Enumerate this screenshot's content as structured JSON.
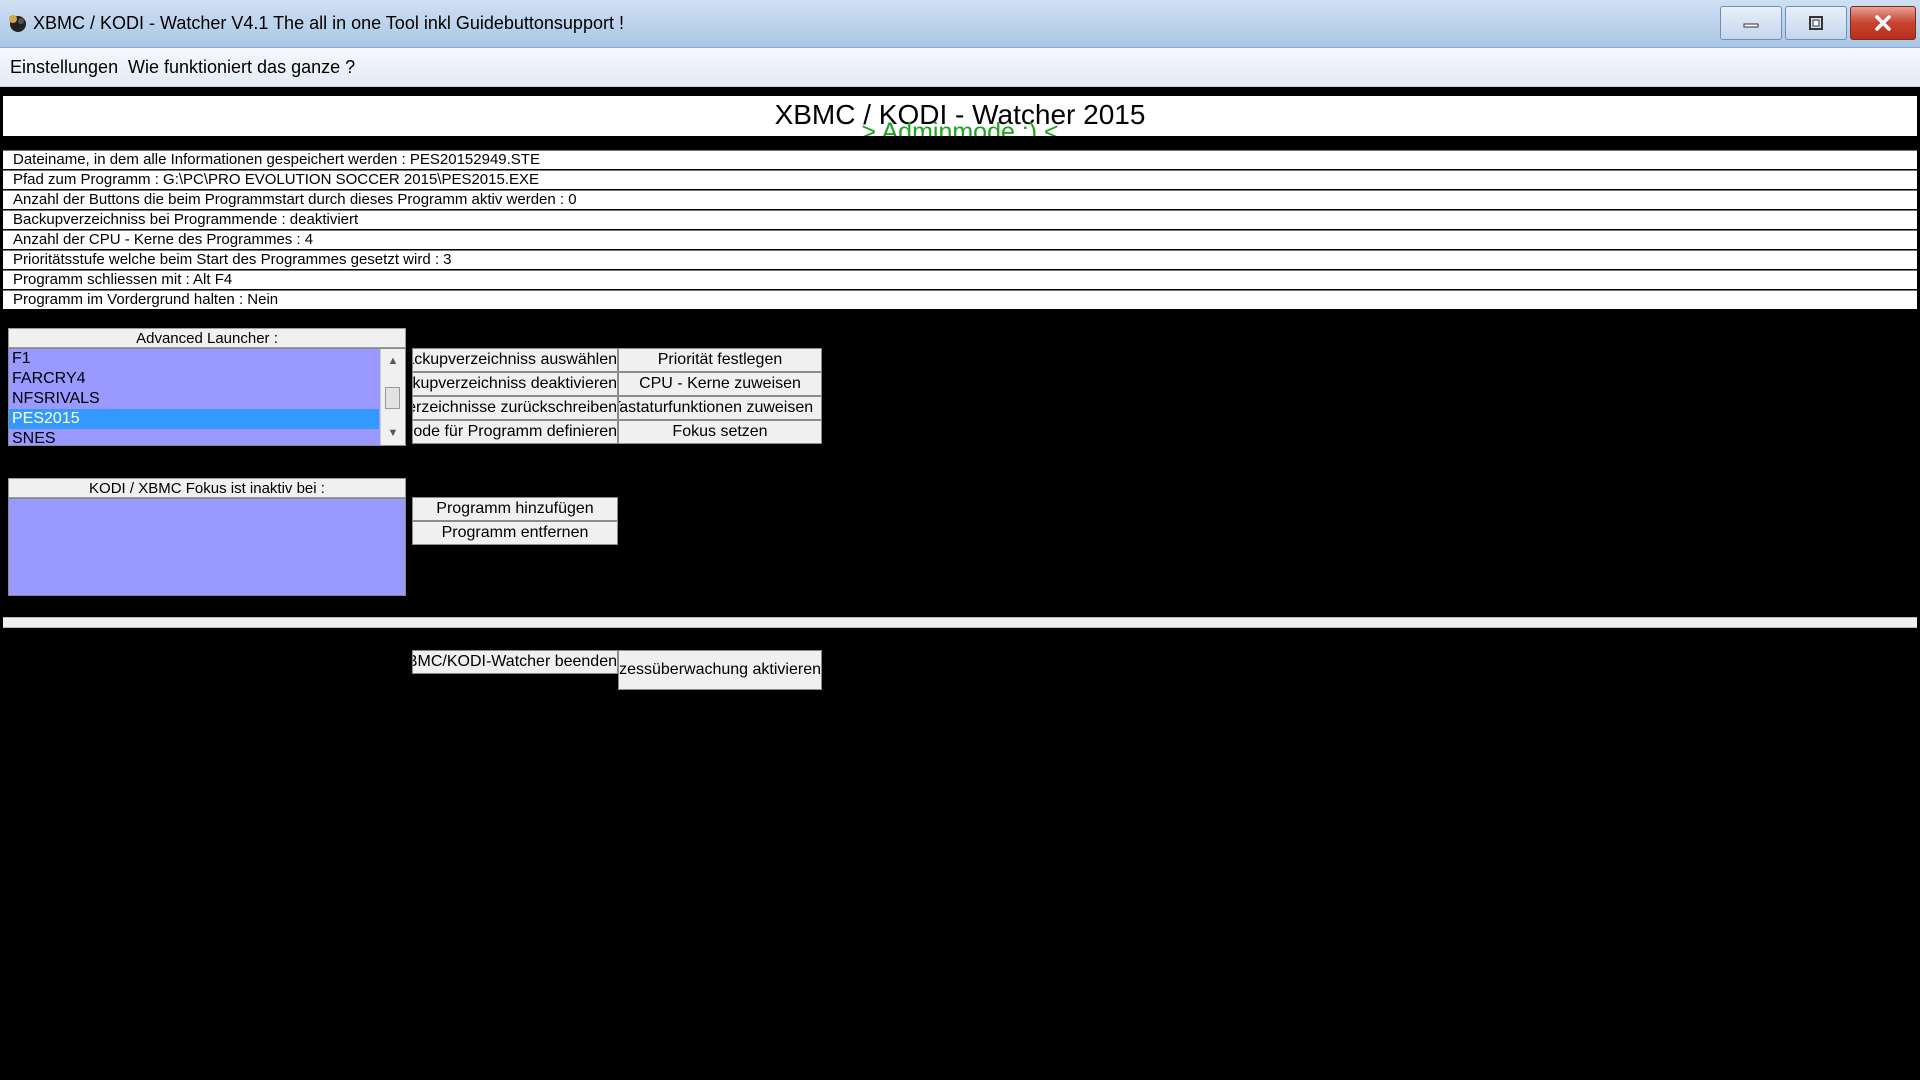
{
  "window": {
    "title": "XBMC / KODI - Watcher V4.1 The all in one Tool inkl Guidebuttonsupport !"
  },
  "menu": {
    "settings": "Einstellungen",
    "howto": "Wie funktioniert das ganze ?"
  },
  "banner": {
    "title": "XBMC / KODI - Watcher 2015",
    "subtitle": "> Adminmode :) <"
  },
  "info": [
    "Dateiname, in dem alle Informationen gespeichert werden : PES20152949.STE",
    "Pfad zum Programm : G:\\PC\\PRO EVOLUTION SOCCER 2015\\PES2015.EXE",
    "Anzahl der Buttons die beim Programmstart durch dieses Programm aktiv werden : 0",
    "Backupverzeichniss bei Programmende : deaktiviert",
    "Anzahl der CPU - Kerne des Programmes : 4",
    "Prioritätsstufe welche beim Start des Programmes gesetzt wird : 3",
    "Programm schliessen mit : Alt F4",
    "Programm im Vordergrund halten  : Nein"
  ],
  "launcher": {
    "header": "Advanced Launcher :",
    "items": [
      "F1",
      "FARCRY4",
      "NFSRIVALS",
      "PES2015",
      "SNES"
    ],
    "selected": "PES2015"
  },
  "focus": {
    "header": "KODI / XBMC Fokus ist inaktiv bei :"
  },
  "buttons": {
    "backup_select": "Backupverzeichniss auswählen",
    "backup_disable": "Backupverzeichniss deaktivieren",
    "backup_reset": "Backupverzeichnisse zurückschreiben",
    "close_method": "Schliessmethode für Programm definieren",
    "priority": "Priorität festlegen",
    "cpu": "CPU - Kerne zuweisen",
    "keys": "Maus und Tastaturfunktionen zuweisen",
    "focus": "Fokus setzen",
    "add_program": "Programm hinzufügen",
    "remove_program": "Programm entfernen",
    "quit_watcher": "XBMC/KODI-Watcher beenden",
    "process_watch": "Prozessüberwachung aktivieren"
  },
  "colors": {
    "list_bg": "#9999ff",
    "selection": "#3399ff",
    "adminmode": "#1ea31e",
    "close_button": "#c7432f"
  },
  "icons": {
    "app": "app-icon",
    "minimize": "minimize-icon",
    "maximize": "maximize-icon",
    "close": "close-icon"
  }
}
